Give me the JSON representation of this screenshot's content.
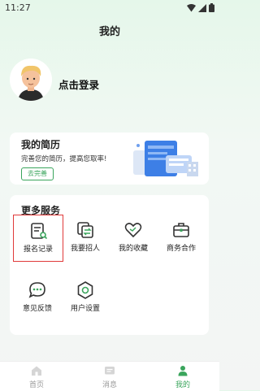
{
  "status": {
    "time": "11:27"
  },
  "header": {
    "title": "我的"
  },
  "profile": {
    "login_label": "点击登录"
  },
  "resume": {
    "title": "我的简历",
    "subtitle": "完善您的简历，提高您取率!",
    "button": "去完善"
  },
  "services": {
    "title": "更多服务",
    "items": [
      {
        "label": "报名记录",
        "icon": "document-search-icon"
      },
      {
        "label": "我要招人",
        "icon": "swap-icon"
      },
      {
        "label": "我的收藏",
        "icon": "heart-icon"
      },
      {
        "label": "商务合作",
        "icon": "briefcase-icon"
      },
      {
        "label": "意见反馈",
        "icon": "chat-bubble-icon"
      },
      {
        "label": "用户设置",
        "icon": "settings-icon"
      }
    ]
  },
  "tabs": [
    {
      "label": "首页",
      "icon": "home-icon",
      "active": false
    },
    {
      "label": "消息",
      "icon": "message-icon",
      "active": false
    },
    {
      "label": "我的",
      "icon": "person-icon",
      "active": true
    }
  ],
  "colors": {
    "accent": "#3aa55c",
    "inactive": "#999999",
    "highlight_border": "#e03a3a"
  }
}
